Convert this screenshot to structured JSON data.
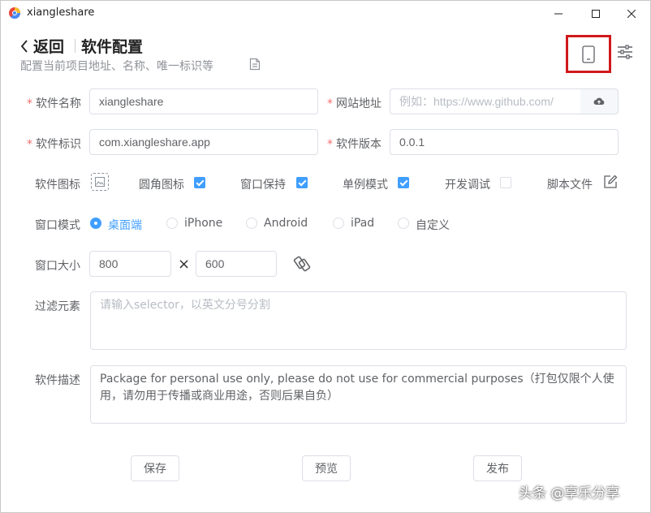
{
  "titlebar": {
    "title": "xiangleshare",
    "buttons": [
      "minimize",
      "maximize",
      "close"
    ]
  },
  "header": {
    "back_label": "返回",
    "title": "软件配置",
    "subtitle": "配置当前项目地址、名称、唯一标识等"
  },
  "form": {
    "name": {
      "label": "软件名称",
      "required": true,
      "value": "xiangleshare"
    },
    "url": {
      "label": "网站地址",
      "required": true,
      "value": "",
      "placeholder": "例如：https://www.github.com/"
    },
    "identifier": {
      "label": "软件标识",
      "required": true,
      "value": "com.xiangleshare.app"
    },
    "version": {
      "label": "软件版本",
      "required": true,
      "value": "0.0.1"
    },
    "icon_row": {
      "icon_label": "软件图标",
      "rounded_label": "圆角图标",
      "rounded_checked": true,
      "keep_window_label": "窗口保持",
      "keep_window_checked": true,
      "single_instance_label": "单例模式",
      "single_instance_checked": true,
      "debug_label": "开发调试",
      "debug_checked": false,
      "script_label": "脚本文件"
    },
    "window_mode": {
      "label": "窗口模式",
      "selected": "桌面端",
      "options": [
        "桌面端",
        "iPhone",
        "Android",
        "iPad",
        "自定义"
      ]
    },
    "window_size": {
      "label": "窗口大小",
      "width": "800",
      "height": "600",
      "separator": "×"
    },
    "filter": {
      "label": "过滤元素",
      "value": "",
      "placeholder": "请输入selector，以英文分号分割"
    },
    "description": {
      "label": "软件描述",
      "value": "Package for personal use only, please do not use for commercial purposes（打包仅限个人使用，请勿用于传播或商业用途，否则后果自负）"
    }
  },
  "actions": {
    "save": "保存",
    "preview": "预览",
    "publish": "发布"
  },
  "watermark": "头条 @享乐分享",
  "colors": {
    "accent": "#409eff",
    "required": "#f56c6c",
    "highlight_box": "#d0191b",
    "border": "#dcdfe6"
  },
  "icons": [
    "app-logo-icon",
    "chevron-left-icon",
    "document-icon",
    "phone-icon",
    "sliders-icon",
    "upload-cloud-icon",
    "image-icon",
    "edit-icon",
    "swap-icon"
  ]
}
